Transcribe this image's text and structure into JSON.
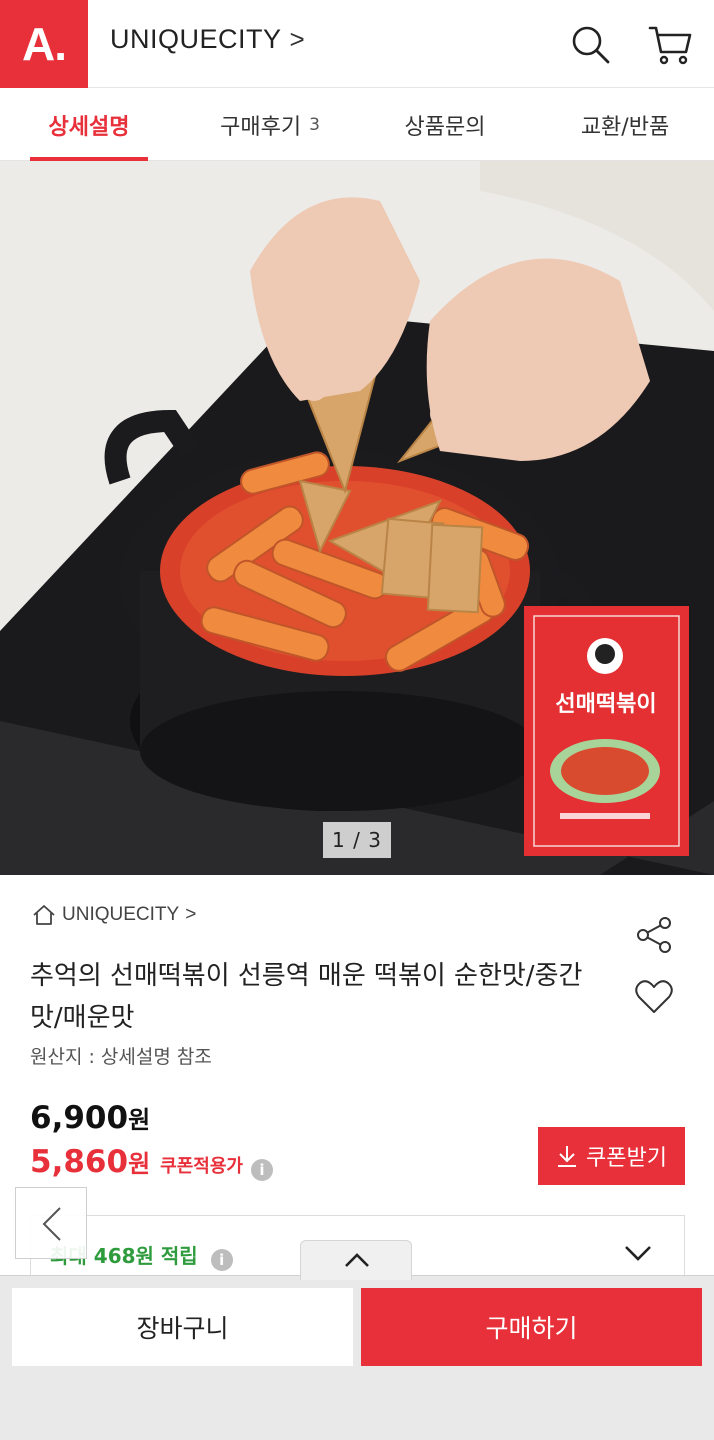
{
  "header": {
    "logo_text": "A.",
    "brand": "UNIQUECITY",
    "brand_chevron": ">",
    "icons": [
      "search-icon",
      "cart-icon"
    ],
    "accent_color": "#e8303a"
  },
  "tabs": [
    {
      "label": "상세설명",
      "active": true
    },
    {
      "label": "구매후기",
      "count": "3",
      "active": false
    },
    {
      "label": "상품문의",
      "active": false
    },
    {
      "label": "교환/반품",
      "active": false
    }
  ],
  "hero": {
    "pager": "1 / 3",
    "package_text": "선매떡볶이"
  },
  "product": {
    "shop_name": "UNIQUECITY",
    "shop_chevron": ">",
    "title": "추억의 선매떡볶이 선릉역 매운 떡볶이 순한맛/중간맛/매운맛",
    "origin": "원산지 : 상세설명 참조",
    "price": "6,900",
    "price_unit": "원",
    "sale_price": "5,860",
    "sale_unit": "원",
    "coupon_label": "쿠폰적용가",
    "coupon_button": "쿠폰받기",
    "points_prefix": "최대",
    "points_value": "468원",
    "points_suffix": "적립"
  },
  "bottom_bar": {
    "cart_label": "장바구니",
    "buy_label": "구매하기"
  }
}
